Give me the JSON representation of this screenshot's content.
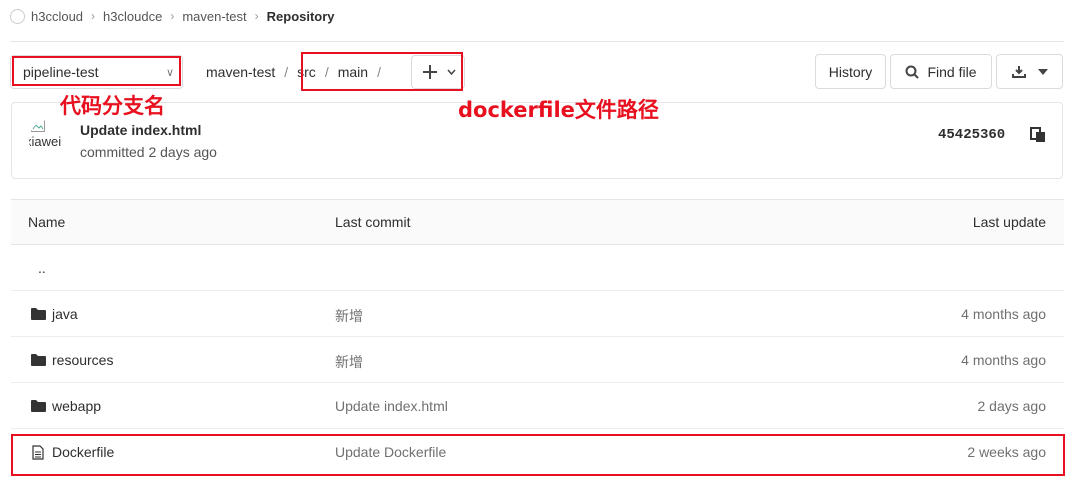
{
  "breadcrumb": [
    "h3ccloud",
    "h3cloudce",
    "maven-test",
    "Repository"
  ],
  "toolbar": {
    "branch": "pipeline-test",
    "path": [
      "maven-test",
      "src",
      "main"
    ],
    "history_label": "History",
    "find_file_label": "Find file"
  },
  "commit": {
    "avatar_alt": "xiawei",
    "title": "Update index.html",
    "meta": "committed 2 days ago",
    "sha": "45425360"
  },
  "table": {
    "headers": [
      "Name",
      "Last commit",
      "Last update"
    ],
    "updir": "..",
    "rows": [
      {
        "name": "java",
        "type": "folder",
        "commit": "新增",
        "date": "4 months ago"
      },
      {
        "name": "resources",
        "type": "folder",
        "commit": "新增",
        "date": "4 months ago"
      },
      {
        "name": "webapp",
        "type": "folder",
        "commit": "Update index.html",
        "date": "2 days ago"
      },
      {
        "name": "Dockerfile",
        "type": "file",
        "commit": "Update Dockerfile",
        "date": "2 weeks ago"
      }
    ]
  },
  "annotations": {
    "branch_note": "代码分支名",
    "path_note": "dockerfile文件路径"
  },
  "colors": {
    "annotation_red": "#e8101f"
  }
}
